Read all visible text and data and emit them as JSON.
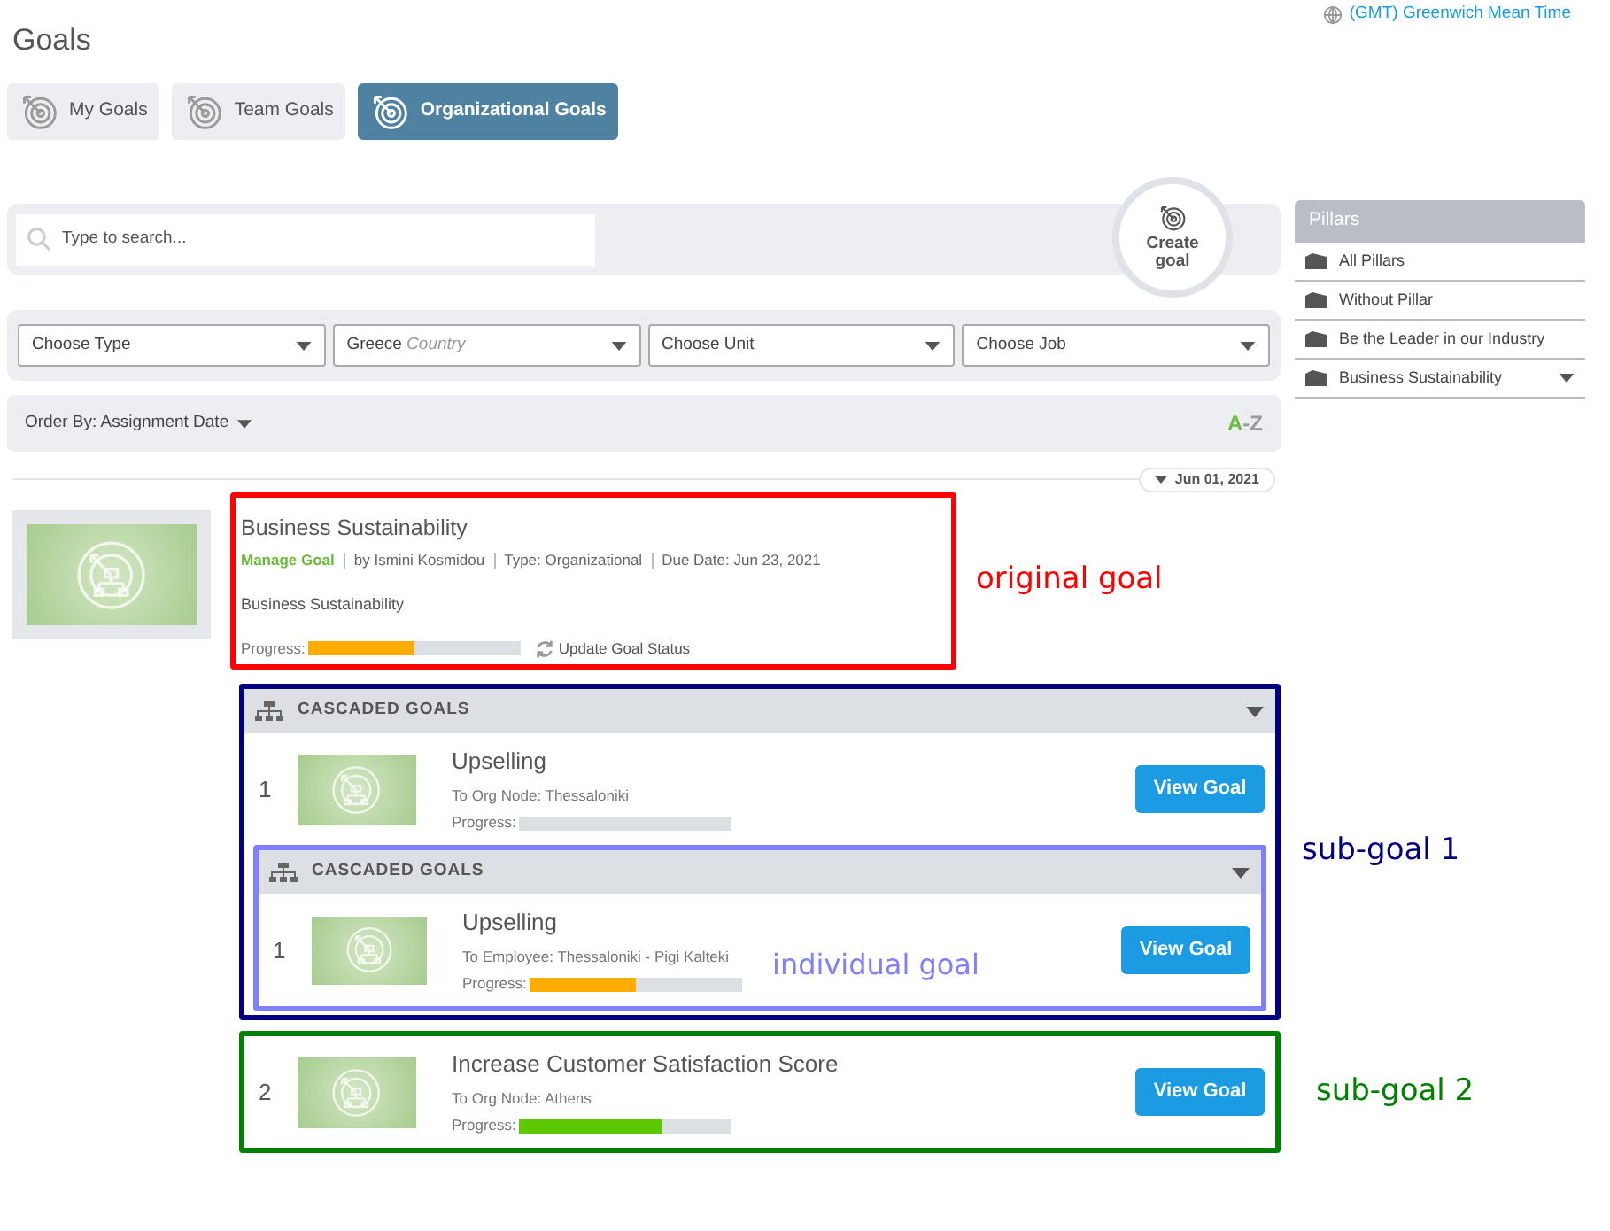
{
  "timezone": "(GMT) Greenwich Mean Time",
  "title": "Goals",
  "tabs": [
    {
      "label": "My Goals",
      "selected": false
    },
    {
      "label": "Team Goals",
      "selected": false
    },
    {
      "label": "Organizational Goals",
      "selected": true
    }
  ],
  "search": {
    "placeholder": "Type to search..."
  },
  "create_button": {
    "line_1": "Create",
    "line_2": "goal"
  },
  "filters": [
    {
      "value": "Choose Type"
    },
    {
      "value": "Greece",
      "hint": "Country"
    },
    {
      "value": "Choose Unit"
    },
    {
      "value": "Choose Job"
    }
  ],
  "order_by": "Order By: Assignment Date",
  "sort": {
    "from": "A",
    "separator": "-",
    "to": "Z"
  },
  "pillars": {
    "title": "Pillars",
    "items": [
      {
        "label": "All Pillars",
        "expandable": false
      },
      {
        "label": "Without Pillar",
        "expandable": false
      },
      {
        "label": "Be the Leader in our Industry",
        "expandable": false
      },
      {
        "label": "Business Sustainability",
        "expandable": true
      }
    ]
  },
  "date_tag": "Jun 01, 2021",
  "goal": {
    "title": "Business Sustainability",
    "manage_link": "Manage Goal",
    "meta": [
      "by Ismini Kosmidou",
      "Type: Organizational",
      "Due Date: Jun 23, 2021"
    ],
    "description": "Business Sustainability",
    "progress_label": "Progress:",
    "level": 0.5,
    "color": "#ffac00",
    "update_status": "Update Goal Status",
    "annotation": {
      "label": "original goal",
      "color": "#ff0000",
      "kind": "outside"
    }
  },
  "cascade": {
    "header": "CASCADED GOALS",
    "expanded": true,
    "annotation": {
      "label": "sub-goal 1",
      "color": "#000080",
      "kind": "outside"
    },
    "items": [
      {
        "number": "1",
        "title": "Upselling",
        "target": "To Org Node: Thessaloniki",
        "progress_label": "Progress:",
        "button": "View Goal",
        "cascade": {
          "header": "CASCADED GOALS",
          "expanded": true,
          "annotation": {
            "label": "individual goal",
            "color": "#8080ff",
            "kind": "inside"
          },
          "items": [
            {
              "number": "1",
              "title": "Upselling",
              "target": "To Employee: Thessaloniki - Pigi Kalteki",
              "progress_label": "Progress:",
              "level": 0.5,
              "color": "#ffac00",
              "button": "View Goal"
            }
          ]
        }
      }
    ]
  },
  "more_items": [
    {
      "number": "2",
      "title": "Increase Customer Satisfaction Score",
      "target": "To Org Node: Athens",
      "progress_label": "Progress:",
      "level": 0.675,
      "color": "#5cc800",
      "button": "View Goal",
      "annotation": {
        "label": "sub-goal 2",
        "color": "#008000",
        "kind": "outside"
      }
    }
  ]
}
